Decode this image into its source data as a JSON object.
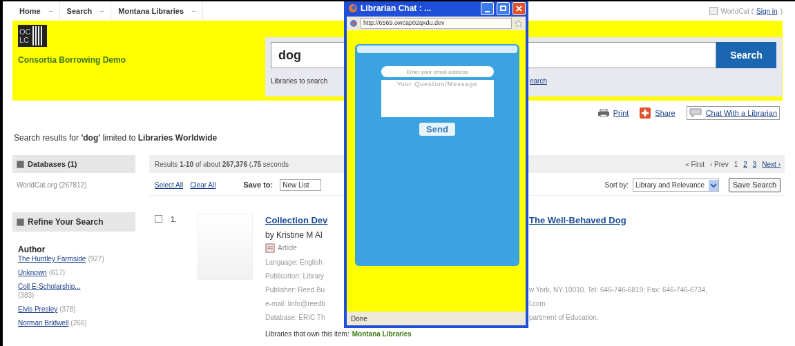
{
  "top_nav": {
    "items": [
      {
        "label": "Home"
      },
      {
        "label": "Search"
      },
      {
        "label": "Montana Libraries"
      }
    ],
    "account_prefix": "WorldCat (",
    "account_link": "Sign in",
    "account_suffix": ")"
  },
  "header": {
    "logo_lines": [
      "OC",
      "LC"
    ],
    "subtitle": "Consortia Borrowing Demo"
  },
  "search": {
    "value": "dog",
    "hint": "Libraries to search",
    "link_fragment": "earch",
    "button": "Search"
  },
  "tools": [
    {
      "kind": "print",
      "label": "Print"
    },
    {
      "kind": "share",
      "label": "Share"
    },
    {
      "kind": "chat",
      "label": "Chat With a Librarian"
    }
  ],
  "results_heading": "Search results for **'dog'** limited to **Libraries Worldwide**",
  "sidebar": {
    "databases": {
      "title": "Databases (1)",
      "items": [
        "WorldCat.org (267812)"
      ]
    },
    "refine": {
      "title": "Refine Your Search",
      "facet": "Author",
      "items": [
        {
          "label": "The Huntley Farmside",
          "count": "(927)"
        },
        {
          "label": "Unknown",
          "count": "(617)"
        },
        {
          "label": "Coll E-Scholarship...",
          "count": "(383)"
        },
        {
          "label": "Elvis Presley",
          "count": "(378)"
        },
        {
          "label": "Norman Bridwell",
          "count": "(266)"
        }
      ]
    }
  },
  "results_bar": {
    "summary": "Results **1-10** of about **267,376** (**.75** seconds",
    "first": "« First",
    "prev": "‹ Prev",
    "pages": [
      {
        "label": "1",
        "selected": true
      },
      {
        "label": "2",
        "selected": false
      },
      {
        "label": "3",
        "selected": false
      }
    ],
    "next": "Next ›"
  },
  "actions": {
    "select_all": "Select All",
    "clear_all": "Clear All",
    "save_to_label": "Save to:",
    "save_to_value": "New List",
    "sort_label": "Sort by:",
    "sort_value": "Library and Relevance",
    "save_search": "Save Search"
  },
  "result": {
    "number": "1.",
    "checked": false,
    "title_left": "Collection Dev",
    "title_right": "The Well-Behaved Dog",
    "author": "by Kristine M Al",
    "format": "Article",
    "lines": [
      {
        "left": "Language: English"
      },
      {
        "left": "Publication: Library"
      },
      {
        "left": "Publisher: Reed Bu",
        "right": "w York, NY 10010. Tel: 646-746-6819; Fax: 646-746-6734,"
      },
      {
        "left": "e-mail: linfo@reedb",
        "right": "l.com"
      },
      {
        "left": "Database: ERIC Th",
        "right": "partment of Education."
      }
    ],
    "holdings_label": "Libraries that own this item:",
    "holdings": "Montana Libraries"
  },
  "chat_window": {
    "title": "Librarian Chat : ...",
    "url": "http://6569.owcap02qxdu.dev",
    "email_placeholder": "Enter your email address",
    "message_placeholder": "Your Question/Message",
    "send": "Send",
    "status": "Done"
  }
}
